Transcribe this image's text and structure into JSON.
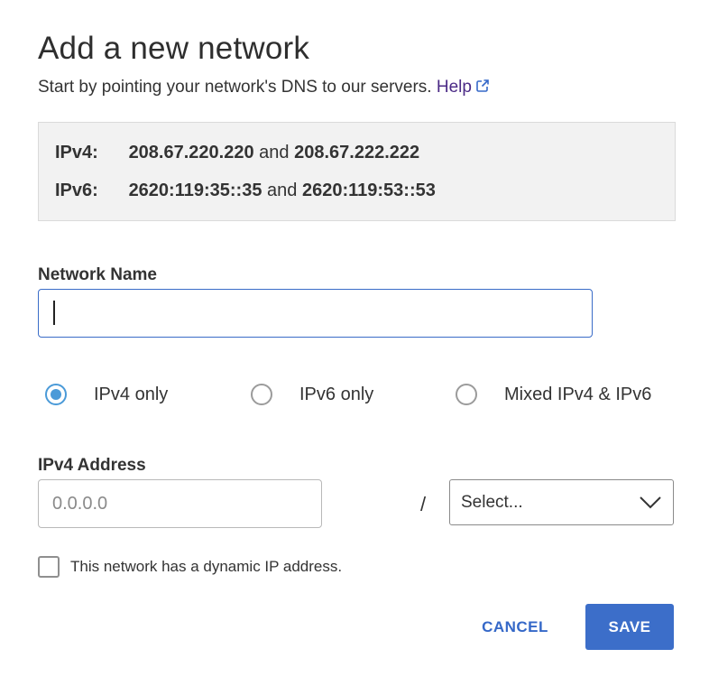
{
  "dialog": {
    "title": "Add a new network",
    "subtitle": "Start by pointing your network's DNS to our servers.",
    "help_label": "Help",
    "help_icon": "external-link-icon"
  },
  "dns": {
    "ipv4": {
      "label": "IPv4:",
      "primary": "208.67.220.220",
      "joiner": "and",
      "secondary": "208.67.222.222"
    },
    "ipv6": {
      "label": "IPv6:",
      "primary": "2620:119:35::35",
      "joiner": "and",
      "secondary": "2620:119:53::53"
    }
  },
  "form": {
    "network_name": {
      "label": "Network Name",
      "value": "",
      "placeholder": ""
    },
    "ip_mode": {
      "options": [
        {
          "label": "IPv4 only",
          "checked": true
        },
        {
          "label": "IPv6 only",
          "checked": false
        },
        {
          "label": "Mixed IPv4 & IPv6",
          "checked": false
        }
      ]
    },
    "ipv4_address": {
      "label": "IPv4 Address",
      "value": "",
      "placeholder": "0.0.0.0",
      "separator": "/"
    },
    "prefix_select": {
      "value": "Select...",
      "icon": "chevron-down-icon"
    },
    "dynamic_ip": {
      "label": "This network has a dynamic IP address.",
      "checked": false
    }
  },
  "actions": {
    "cancel_label": "CANCEL",
    "save_label": "SAVE"
  },
  "colors": {
    "accent": "#3c6ec9",
    "link": "#4b2a86",
    "radio_checked": "#4a9ad8",
    "dns_box_bg": "#f2f2f2"
  }
}
